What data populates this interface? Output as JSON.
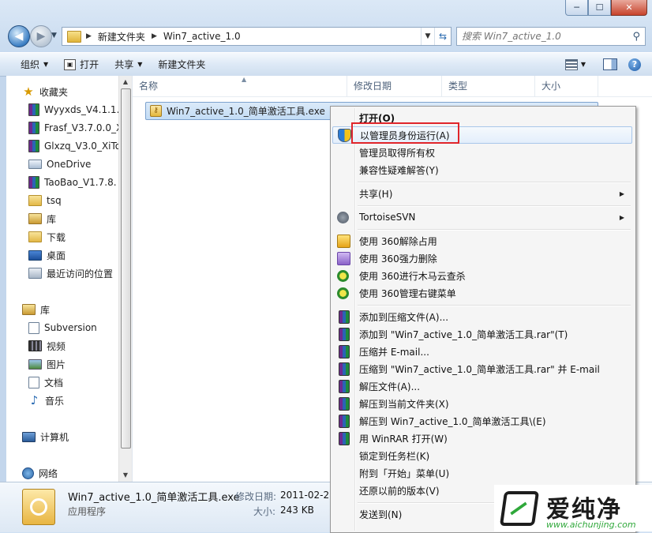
{
  "window": {
    "caption": {
      "minimize": "─",
      "maximize": "☐",
      "close": "✕"
    }
  },
  "nav": {
    "breadcrumb": [
      "新建文件夹",
      "Win7_active_1.0"
    ],
    "search_placeholder": "搜索 Win7_active_1.0"
  },
  "toolbar": {
    "organize": "组织",
    "open": "打开",
    "share": "共享",
    "new_folder": "新建文件夹"
  },
  "sidebar": {
    "favorites_label": "收藏夹",
    "favorites": [
      "Wyyxds_V4.1.1.",
      "Frasf_V3.7.0.0_X",
      "Glxzq_V3.0_XiTo",
      "OneDrive",
      "TaoBao_V1.7.8.",
      "tsq",
      "库",
      "下载",
      "桌面",
      "最近访问的位置"
    ],
    "libraries_label": "库",
    "libraries": [
      "Subversion",
      "视频",
      "图片",
      "文档",
      "音乐"
    ],
    "computer_label": "计算机",
    "network_label": "网络"
  },
  "columns": {
    "name": "名称",
    "date": "修改日期",
    "type": "类型",
    "size": "大小"
  },
  "file": {
    "name": "Win7_active_1.0_简单激活工具.exe"
  },
  "context_menu": [
    {
      "label": "打开(O)",
      "bold": true
    },
    {
      "label": "以管理员身份运行(A)",
      "icon": "uac-shield-icon",
      "highlighted": true
    },
    {
      "label": "管理员取得所有权"
    },
    {
      "label": "兼容性疑难解答(Y)"
    },
    {
      "label": "共享(H)",
      "submenu": true
    },
    {
      "label": "TortoiseSVN",
      "icon": "tortoisesvn-icon",
      "submenu": true
    },
    {
      "label": "使用 360解除占用",
      "icon": "360-unlock-icon"
    },
    {
      "label": "使用 360强力删除",
      "icon": "360-delete-icon"
    },
    {
      "label": "使用 360进行木马云查杀",
      "icon": "360-scan-icon"
    },
    {
      "label": "使用 360管理右键菜单",
      "icon": "360-menu-icon"
    },
    {
      "label": "添加到压缩文件(A)...",
      "icon": "winrar-icon"
    },
    {
      "label": "添加到 \"Win7_active_1.0_简单激活工具.rar\"(T)",
      "icon": "winrar-icon"
    },
    {
      "label": "压缩并 E-mail...",
      "icon": "winrar-icon"
    },
    {
      "label": "压缩到 \"Win7_active_1.0_简单激活工具.rar\" 并 E-mail",
      "icon": "winrar-icon"
    },
    {
      "label": "解压文件(A)...",
      "icon": "winrar-icon"
    },
    {
      "label": "解压到当前文件夹(X)",
      "icon": "winrar-icon"
    },
    {
      "label": "解压到 Win7_active_1.0_简单激活工具\\(E)",
      "icon": "winrar-icon"
    },
    {
      "label": "用 WinRAR 打开(W)",
      "icon": "winrar-icon"
    },
    {
      "label": "锁定到任务栏(K)"
    },
    {
      "label": "附到「开始」菜单(U)"
    },
    {
      "label": "还原以前的版本(V)"
    },
    {
      "label": "发送到(N)",
      "submenu": true
    }
  ],
  "details": {
    "name": "Win7_active_1.0_简单激活工具.exe",
    "type": "应用程序",
    "modified_label": "修改日期:",
    "modified_value": "2011-02-25",
    "size_label": "大小:",
    "size_value": "243 KB"
  },
  "watermark": {
    "title": "爱纯净",
    "url": "www.aichunjing.com"
  },
  "colors": {
    "highlight_box": "#e0252b",
    "selection": "#c3dcf5",
    "accent": "#2fa83a"
  }
}
